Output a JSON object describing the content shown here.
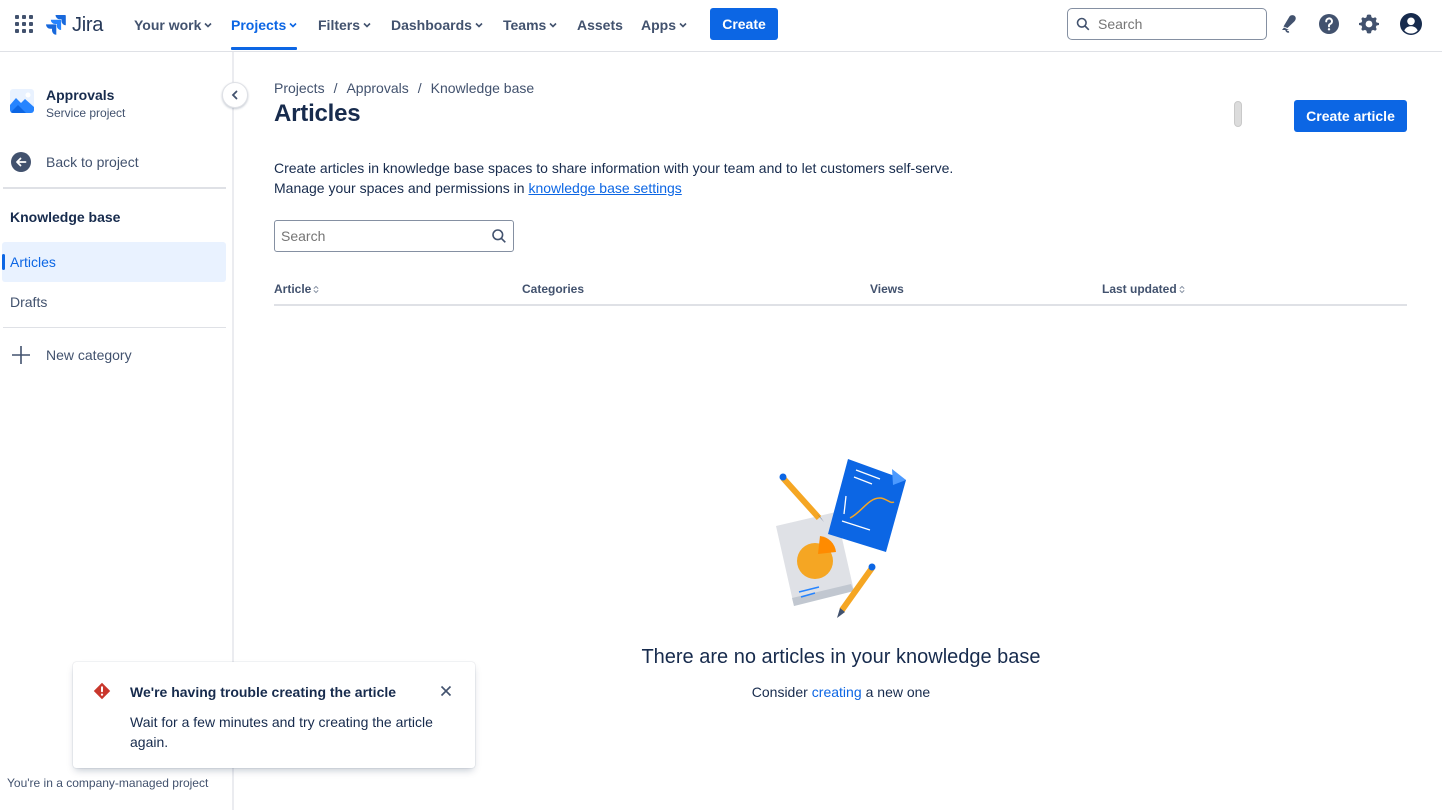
{
  "topnav": {
    "logo_text": "Jira",
    "items": [
      {
        "label": "Your work",
        "has_dropdown": true
      },
      {
        "label": "Projects",
        "has_dropdown": true,
        "active": true
      },
      {
        "label": "Filters",
        "has_dropdown": true
      },
      {
        "label": "Dashboards",
        "has_dropdown": true
      },
      {
        "label": "Teams",
        "has_dropdown": true
      },
      {
        "label": "Assets",
        "has_dropdown": false
      },
      {
        "label": "Apps",
        "has_dropdown": true
      }
    ],
    "create_label": "Create",
    "search_placeholder": "Search",
    "icons": [
      "notifications-icon",
      "help-icon",
      "settings-icon",
      "profile-avatar-icon"
    ]
  },
  "sidebar": {
    "project_name": "Approvals",
    "project_type": "Service project",
    "back_label": "Back to project",
    "section_heading": "Knowledge base",
    "items": [
      {
        "label": "Articles",
        "selected": true
      },
      {
        "label": "Drafts",
        "selected": false
      }
    ],
    "new_category_label": "New category",
    "footer_note": "You're in a company-managed project"
  },
  "main": {
    "breadcrumb": [
      "Projects",
      "Approvals",
      "Knowledge base"
    ],
    "breadcrumb_separator": "/",
    "title": "Articles",
    "create_article_label": "Create article",
    "description_line1": "Create articles in knowledge base spaces to share information with your team and to let customers self-serve.",
    "description_line2_prefix": "Manage your spaces and permissions in ",
    "description_link": "knowledge base settings",
    "search_placeholder": "Search",
    "table_columns": [
      {
        "label": "Article",
        "sortable": true
      },
      {
        "label": "Categories",
        "sortable": false
      },
      {
        "label": "Views",
        "sortable": false
      },
      {
        "label": "Last updated",
        "sortable": true
      }
    ],
    "empty_title": "There are no articles in your knowledge base",
    "empty_sub_prefix": "Consider",
    "empty_sub_link": "creating",
    "empty_sub_suffix": "a new one"
  },
  "flag": {
    "title": "We're having trouble creating the article",
    "body": "Wait for a few minutes and try creating the article again.",
    "icon": "error-icon",
    "color": "#c9372c"
  },
  "colors": {
    "accent": "#0c66e4",
    "text": "#172b4d",
    "subtle_text": "#42526e",
    "error": "#c9372c",
    "selected_bg": "#e9f2ff"
  }
}
